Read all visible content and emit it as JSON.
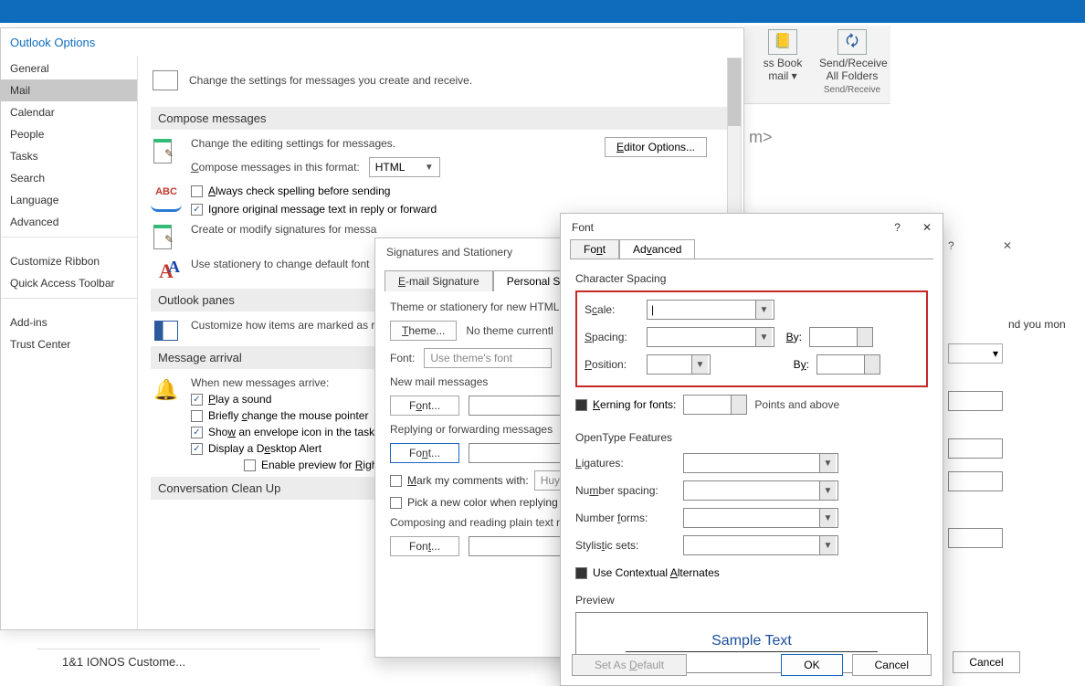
{
  "bluebar": {},
  "ribbon": {
    "btn1_l1": "ss Book",
    "btn1_l2": "mail ▾",
    "btn2_l1": "Send/Receive",
    "btn2_l2": "All Folders",
    "btn2_group": "Send/Receive"
  },
  "reading_hint": "m>",
  "back_text1": "nd you mon",
  "back_cancel": "Cancel",
  "list_item_title": "1&1 IONOS Custome...",
  "options": {
    "title": "Outlook Options",
    "nav": [
      "General",
      "Mail",
      "Calendar",
      "People",
      "Tasks",
      "Search",
      "Language",
      "Advanced",
      "Customize Ribbon",
      "Quick Access Toolbar",
      "Add-ins",
      "Trust Center"
    ],
    "nav_selected": 1,
    "intro": "Change the settings for messages you create and receive.",
    "sect_compose": "Compose messages",
    "compose_edit_lbl": "Change the editing settings for messages.",
    "editor_btn": "Editor Options...",
    "compose_fmt_lbl": "Compose messages in this format:",
    "compose_fmt_val": "HTML",
    "chk_spell": "Always check spelling before sending",
    "chk_ignore": "Ignore original message text in reply or forward",
    "sig_lbl": "Create or modify signatures for messa",
    "stationery_lbl": "Use stationery to change default font",
    "sect_panes": "Outlook panes",
    "panes_lbl": "Customize how items are marked as r",
    "sect_arrival": "Message arrival",
    "arrival_lbl": "When new messages arrive:",
    "chk_sound": "Play a sound",
    "chk_pointer": "Briefly change the mouse pointer",
    "chk_envelope": "Show an envelope icon in the task",
    "chk_desktop": "Display a Desktop Alert",
    "chk_preview": "Enable preview for Rights Prote",
    "sect_cleanup": "Conversation Clean Up"
  },
  "sig": {
    "title": "Signatures and Stationery",
    "tab1": "E-mail Signature",
    "tab2": "Personal Station",
    "theme_hdr": "Theme or stationery for new HTML e",
    "theme_btn": "Theme...",
    "no_theme": "No theme currentl",
    "font_lbl": "Font:",
    "font_val": "Use theme's font",
    "new_msgs": "New mail messages",
    "font_btn": "Font...",
    "reply_hdr": "Replying or forwarding messages",
    "mark_comments": "Mark my comments with:",
    "mark_val": "Huy",
    "pick_color": "Pick a new color when replying",
    "plain_hdr": "Composing and reading plain text m"
  },
  "font": {
    "title": "Font",
    "help": "?",
    "close": "✕",
    "tab_font": "Font",
    "tab_adv": "Advanced",
    "grp_spacing": "Character Spacing",
    "lbl_scale": "Scale:",
    "lbl_spacing": "Spacing:",
    "lbl_position": "Position:",
    "lbl_by": "By:",
    "lbl_kerning": "Kerning for fonts:",
    "kerning_after": "Points and above",
    "grp_opentype": "OpenType Features",
    "lbl_liga": "Ligatures:",
    "lbl_numspace": "Number spacing:",
    "lbl_numforms": "Number forms:",
    "lbl_stylistic": "Stylistic sets:",
    "chk_contextual": "Use Contextual Alternates",
    "grp_preview": "Preview",
    "preview_text": "Sample Text",
    "btn_default": "Set As Default",
    "btn_ok": "OK",
    "btn_cancel": "Cancel"
  }
}
